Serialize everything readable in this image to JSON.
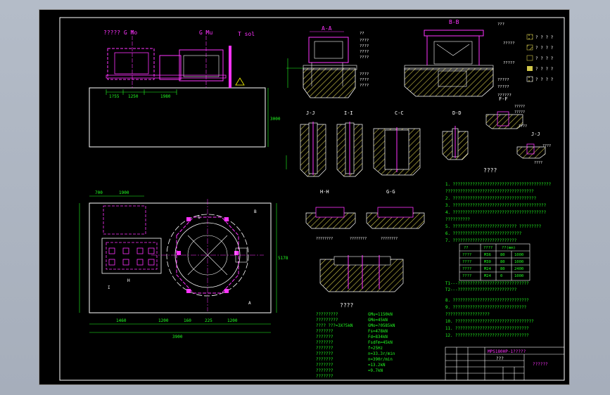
{
  "colors": {
    "background": "#000000",
    "frame": "#ffffff",
    "outline": "#ffffff",
    "green": "#22ff22",
    "magenta": "#ff33ff",
    "yellow": "#ffff00",
    "cyan": "#00ffff",
    "hatch": "#d2c84a"
  },
  "elevation": {
    "label_left": "????? G Mo",
    "label_mid": "G Mu",
    "label_right": "T sol",
    "dims": [
      "1?55",
      "1250",
      "1980"
    ],
    "height_dim": "3000"
  },
  "sections": {
    "aa": {
      "title": "A-A",
      "callouts": [
        "??",
        "????",
        "????",
        "????",
        "????",
        "????",
        "????",
        "????"
      ]
    },
    "bb": {
      "title": "B-B",
      "callouts": [
        "???",
        "?????",
        "?????",
        "?????",
        "?????",
        "??????"
      ]
    },
    "ff": {
      "title": "F-F",
      "callouts": [
        "?????",
        "?????",
        "????"
      ]
    },
    "jj": {
      "title": "J-J"
    },
    "ii": {
      "title": "I-I"
    },
    "cc": {
      "title": "C-C"
    },
    "dd": {
      "title": "D-D"
    },
    "kk": {
      "title": "J-J",
      "callouts": [
        "????",
        "????"
      ]
    },
    "hh": {
      "title": "H-H"
    },
    "gg": {
      "title": "G-G"
    },
    "ee": {
      "callouts": [
        "????????",
        "????????",
        "????????"
      ]
    }
  },
  "plan": {
    "dims_top": [
      "700",
      "1900"
    ],
    "dims_bottom": [
      "1460",
      "1200",
      "160",
      "225",
      "1200"
    ],
    "total": "3900",
    "height": "5178",
    "labels": [
      "H",
      "I",
      "G",
      "B",
      "A"
    ]
  },
  "legend": {
    "items": [
      {
        "label": "? ? ? ?",
        "icon": "hatch-icon"
      },
      {
        "label": "? ? ? ?",
        "icon": "concrete-icon"
      },
      {
        "label": "? ? ? ?",
        "icon": "grout-icon"
      },
      {
        "label": "? ? ? ?",
        "icon": "fill-icon"
      },
      {
        "label": "? ? ? ?",
        "icon": "aggregate-icon"
      }
    ]
  },
  "notes": {
    "title": "????",
    "lines": [
      "1. ????????????????????????????????????????",
      "  ????????????????????????????????????",
      "2. ??????????????????????????????????",
      "3. ??????????????????????????????????????",
      "4. ??????????????????????????????????????",
      "  ??????????",
      "5. ?????????????????????????? ?????????",
      "6. ????????????????????????????",
      "7. ??????????????????????????",
      "T1---?????????????????????????????",
      "T2---????????????????????????",
      "8. ???????????????????????????????",
      "9. ??????????????????????????????",
      "  ??????????????????",
      "10. ????????????????????????????????",
      "11. ??????????????????????????????",
      "12. ??????????????????????????????"
    ]
  },
  "bolt_table": {
    "headers": [
      "??",
      "????",
      "??(mm)"
    ],
    "rows": [
      [
        "????",
        "M36",
        "80",
        "1000"
      ],
      [
        "????",
        "M30",
        "80",
        "1000"
      ],
      [
        "????",
        "M24",
        "80",
        "2400"
      ],
      [
        "????",
        "M24",
        "0",
        "1000"
      ]
    ]
  },
  "params": {
    "title": "????",
    "left": [
      "?????????",
      "?????????",
      "????  ???=3X?5kN",
      "???????",
      "???????",
      "???????",
      "???????",
      "???????",
      "???????",
      "???????",
      "???????",
      "???????"
    ],
    "right": [
      "GMu=1150kN",
      "GMo=45kN",
      "GMo=?0585kN",
      "Fs=478kN",
      "Fd=834kN",
      "FsdFm=45kN",
      "f=25Hz",
      "n=33.3r/min",
      "n=390r/min",
      "=13.2kN",
      "=9.7kN"
    ]
  },
  "title_block": {
    "drawing_name": "MPS180HP-1?????",
    "subtitle": "???",
    "footer": "??????"
  }
}
